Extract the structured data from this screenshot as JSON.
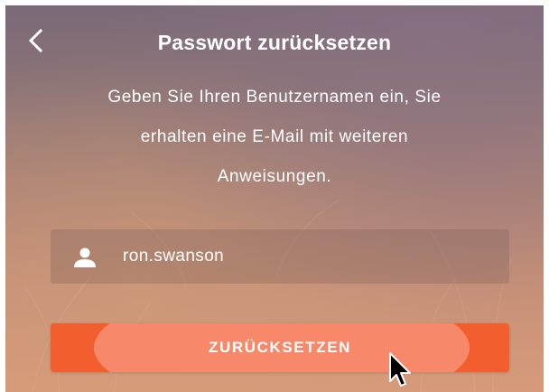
{
  "header": {
    "back_icon": "chevron-left-icon",
    "title": "Passwort zurücksetzen"
  },
  "description": {
    "lines": [
      "Geben Sie Ihren Benutzernamen ein, Sie",
      "erhalten eine E-Mail mit weiteren",
      "Anweisungen."
    ]
  },
  "username_field": {
    "icon": "user-icon",
    "value": "ron.swanson"
  },
  "submit_button": {
    "label": "ZURÜCKSETZEN"
  },
  "colors": {
    "accent": "#f35e2f",
    "accent_hover": "#f7896a",
    "text": "#ffffff"
  }
}
